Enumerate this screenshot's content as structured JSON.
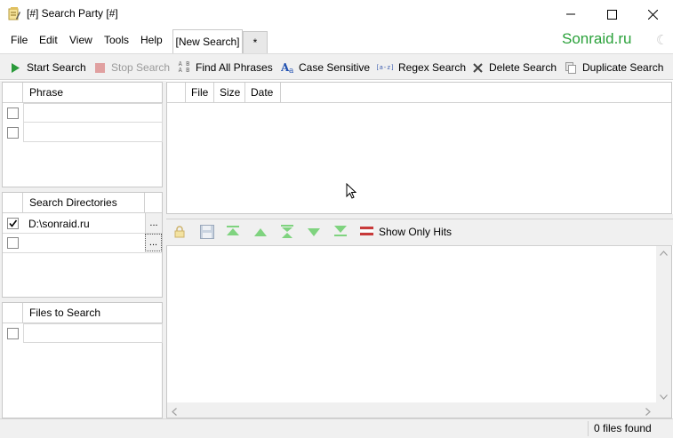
{
  "window": {
    "title": "[#] Search Party [#]",
    "minimize": "—",
    "maximize": "☐",
    "close": "✕"
  },
  "menu": {
    "items": [
      "File",
      "Edit",
      "View",
      "Tools",
      "Help"
    ],
    "tabs": [
      "[New Search]",
      "*"
    ],
    "brand": "Sonraid.ru",
    "theme_icon": "moon-icon"
  },
  "toolbar": {
    "buttons": [
      {
        "label": "Start Search",
        "icon": "play-icon",
        "enabled": true
      },
      {
        "label": "Stop Search",
        "icon": "stop-icon",
        "enabled": false
      },
      {
        "label": "Find All Phrases",
        "icon": "find-all-icon",
        "enabled": true
      },
      {
        "label": "Case Sensitive",
        "icon": "case-icon",
        "enabled": true
      },
      {
        "label": "Regex Search",
        "icon": "regex-icon",
        "enabled": true
      },
      {
        "label": "Delete Search",
        "icon": "delete-icon",
        "enabled": true
      },
      {
        "label": "Duplicate Search",
        "icon": "duplicate-icon",
        "enabled": true
      }
    ],
    "regex_badge": "[a-z]",
    "find_all_badge": "A B"
  },
  "phrase_panel": {
    "header": "Phrase",
    "rows": [
      {
        "checked": false,
        "text": ""
      },
      {
        "checked": false,
        "text": ""
      }
    ]
  },
  "directories_panel": {
    "header": "Search Directories",
    "rows": [
      {
        "checked": true,
        "path": "D:\\sonraid.ru",
        "browse": "..."
      },
      {
        "checked": false,
        "path": "",
        "browse": "..."
      }
    ]
  },
  "files_panel": {
    "header": "Files to Search",
    "rows": [
      {
        "checked": false,
        "text": ""
      }
    ]
  },
  "results": {
    "columns": [
      "File",
      "Size",
      "Date"
    ]
  },
  "preview_toolbar": {
    "show_only_hits": "Show Only Hits"
  },
  "status": {
    "files_found": "0 files found"
  },
  "colors": {
    "accent_green": "#2aa13a",
    "toolbar_bg": "#f0f0f0",
    "nav_arrow_green": "#7fd37f"
  }
}
